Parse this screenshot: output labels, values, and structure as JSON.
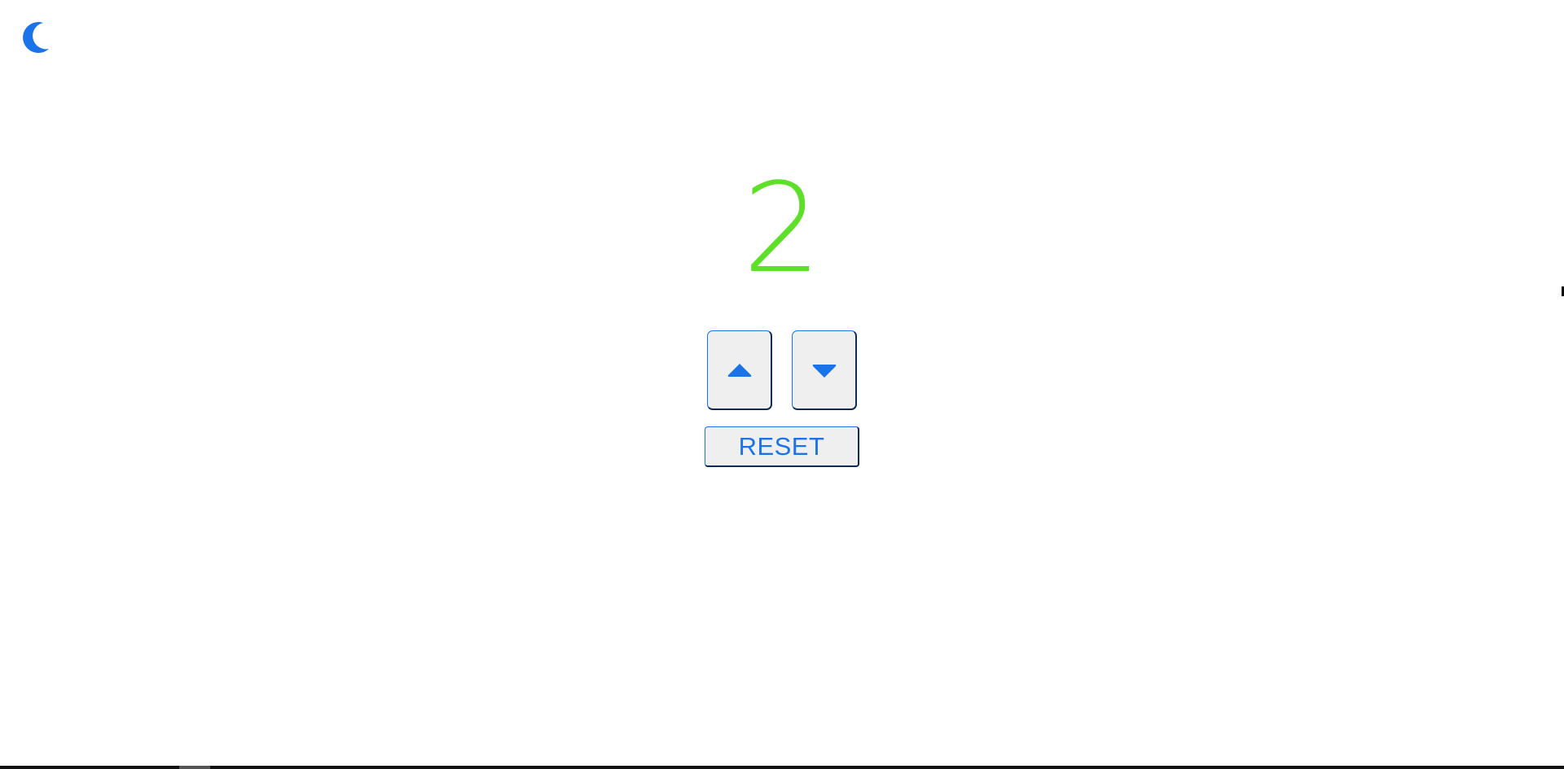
{
  "theme_toggle": {
    "icon": "moon-icon",
    "color": "#1a73e8"
  },
  "counter": {
    "value": "2",
    "color": "#5ee02a"
  },
  "controls": {
    "increment_icon": "caret-up-icon",
    "decrement_icon": "caret-down-icon",
    "reset_label": "RESET",
    "accent_color": "#1a73e8"
  }
}
